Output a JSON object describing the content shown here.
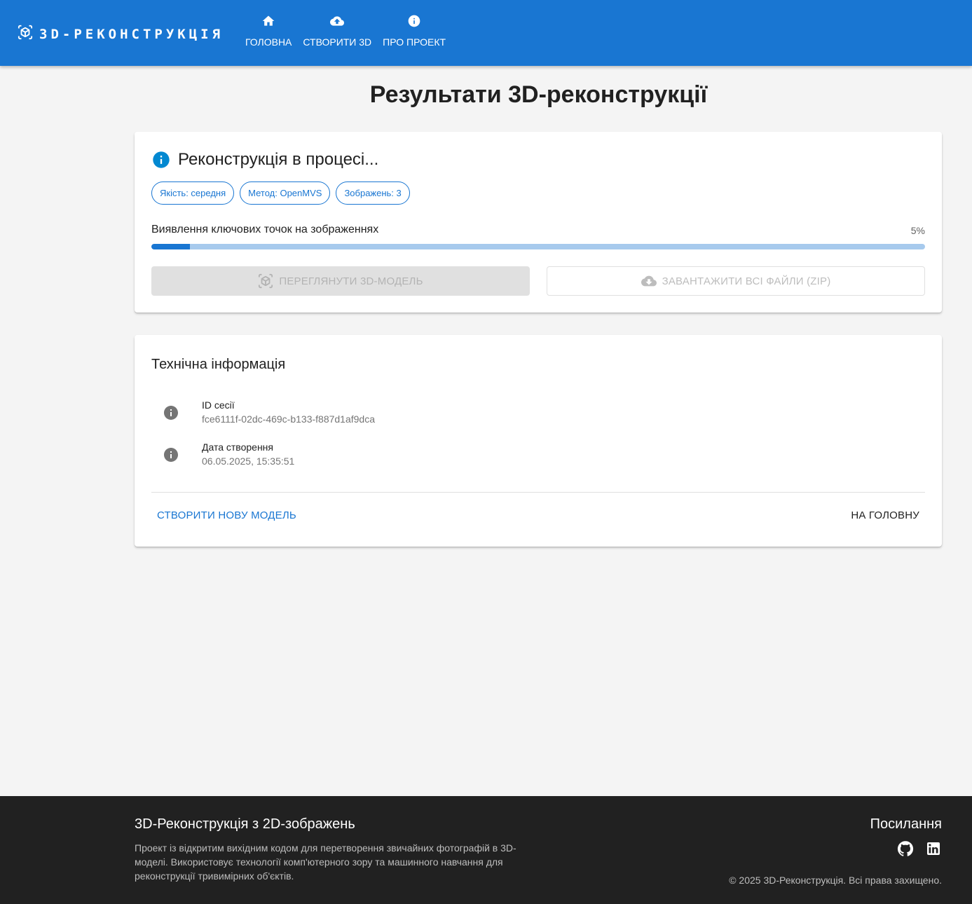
{
  "colors": {
    "primary": "#1976d2",
    "background": "#f4f4f4",
    "footer": "#212121",
    "progress_track": "#a7caed"
  },
  "header": {
    "brand": "3D-РЕКОНСТРУКЦІЯ",
    "brand_icon": "view-in-ar-icon",
    "nav": [
      {
        "label": "ГОЛОВНА",
        "icon": "home-icon"
      },
      {
        "label": "СТВОРИТИ 3D",
        "icon": "cloud-upload-icon"
      },
      {
        "label": "ПРО ПРОЕКТ",
        "icon": "info-icon"
      }
    ]
  },
  "main": {
    "title": "Результати 3D-реконструкції",
    "status": {
      "text": "Реконструкція в процесі...",
      "icon": "info-icon",
      "chips": [
        "Якість: середня",
        "Метод: OpenMVS",
        "Зображень: 3"
      ],
      "step": "Виявлення ключових точок на зображеннях",
      "progress_percent": 5,
      "progress_label": "5%",
      "view_button": "ПЕРЕГЛЯНУТИ 3D-МОДЕЛЬ",
      "download_button": "ЗАВАНТАЖИТИ ВСІ ФАЙЛИ (ZIP)"
    },
    "tech": {
      "title": "Технічна інформація",
      "items": [
        {
          "label": "ID сесії",
          "value": "fce6111f-02dc-469c-b133-f887d1af9dca"
        },
        {
          "label": "Дата створення",
          "value": "06.05.2025, 15:35:51"
        }
      ],
      "new_model": "СТВОРИТИ НОВУ МОДЕЛЬ",
      "go_home": "НА ГОЛОВНУ"
    }
  },
  "footer": {
    "title": "3D-Реконструкція з 2D-зображень",
    "description": "Проект із відкритим вихідним кодом для перетворення звичайних фотографій в 3D-моделі. Використовує технології комп'ютерного зору та машинного навчання для реконструкції тривимірних об'єктів.",
    "links_title": "Посилання",
    "copyright": "© 2025 3D-Реконструкція. Всі права захищено."
  }
}
